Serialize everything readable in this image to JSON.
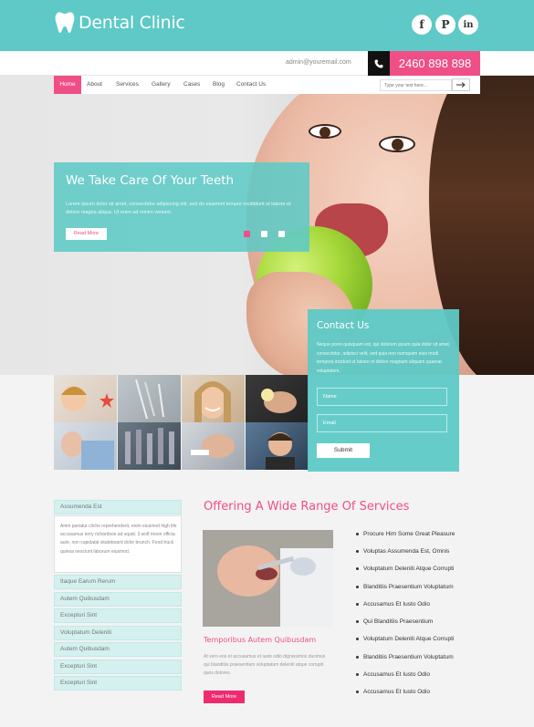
{
  "header": {
    "brand": "Dental Clinic",
    "social": [
      {
        "name": "facebook-icon",
        "glyph": "f"
      },
      {
        "name": "pinterest-icon",
        "glyph": "P"
      },
      {
        "name": "linkedin-icon",
        "glyph": "in"
      }
    ]
  },
  "contact_bar": {
    "email": "admin@youremail.com",
    "phone": "2460 898 898"
  },
  "nav": {
    "items": [
      "Home",
      "About",
      "Services",
      "Gallery",
      "Cases",
      "Blog",
      "Contact Us"
    ],
    "search_placeholder": "Type your text here..."
  },
  "hero": {
    "title": "We Take Care Of Your Teeth",
    "text": "Lorem ipsum dolor sit amet, consectetur adipiscing elit, sed do eiusmod tempor incididunt ut labore et dolore magna aliqua. Ut enim ad minim veniam.",
    "button": "Read More"
  },
  "contact_form": {
    "title": "Contact Us",
    "text": "Neque porro quisquam est, qui dolorem ipsum quia dolor sit amet, consectetur, adipisci velit, sed quia non numquam eius modi tempora incidunt ut labore et dolore magnam aliquam quaerat voluptatem.",
    "name_placeholder": "Name",
    "email_placeholder": "Email",
    "submit": "Submit"
  },
  "accordion": {
    "open_title": "Assumenda Est",
    "open_text": "Anim pariatur cliche reprehenderit, enim eiusmod high life accusamus terry richardson ad squid. 3 wolf moon officia aute, non cupidatat skateboard dolor brunch. Food truck quinoa nesciunt laborum eiusmod.",
    "items": [
      "Itaque Earum Rerum",
      "Autem Quibusdam",
      "Excepturi Sint",
      "Voluptatum Deleniti",
      "Autem Quibusdam",
      "Excepturi Sint",
      "Excepturi Sint"
    ]
  },
  "services": {
    "title": "Offering A Wide Range Of Services",
    "sub_title": "Temporibus Autem Quibusdam",
    "text": "At vero eos et accusamus et iusto odio dignissimos ducimus qui blanditiis praesentium voluptatum deleniti atque corrupti quos dolores.",
    "button": "Read More",
    "list": [
      "Procure Him Some Great Pleasure",
      "Voluptas Assumenda Est, Omnis",
      "Voluptatum Deleniti Atque Corrupti",
      "Blanditiis Praesentium Voluptatum",
      "Accusamus Et Iusto Odio",
      "Qui Blanditiis Praesentium",
      "Voluptatum Deleniti Atque Corrupti",
      "Blanditiis Praesentium Voluptatum",
      "Accusamus Et Iusto Odio",
      "Accusamus Et Iusto Odio"
    ]
  },
  "colors": {
    "teal": "#5ec9c6",
    "pink": "#ef4f86",
    "dark": "#111111"
  }
}
